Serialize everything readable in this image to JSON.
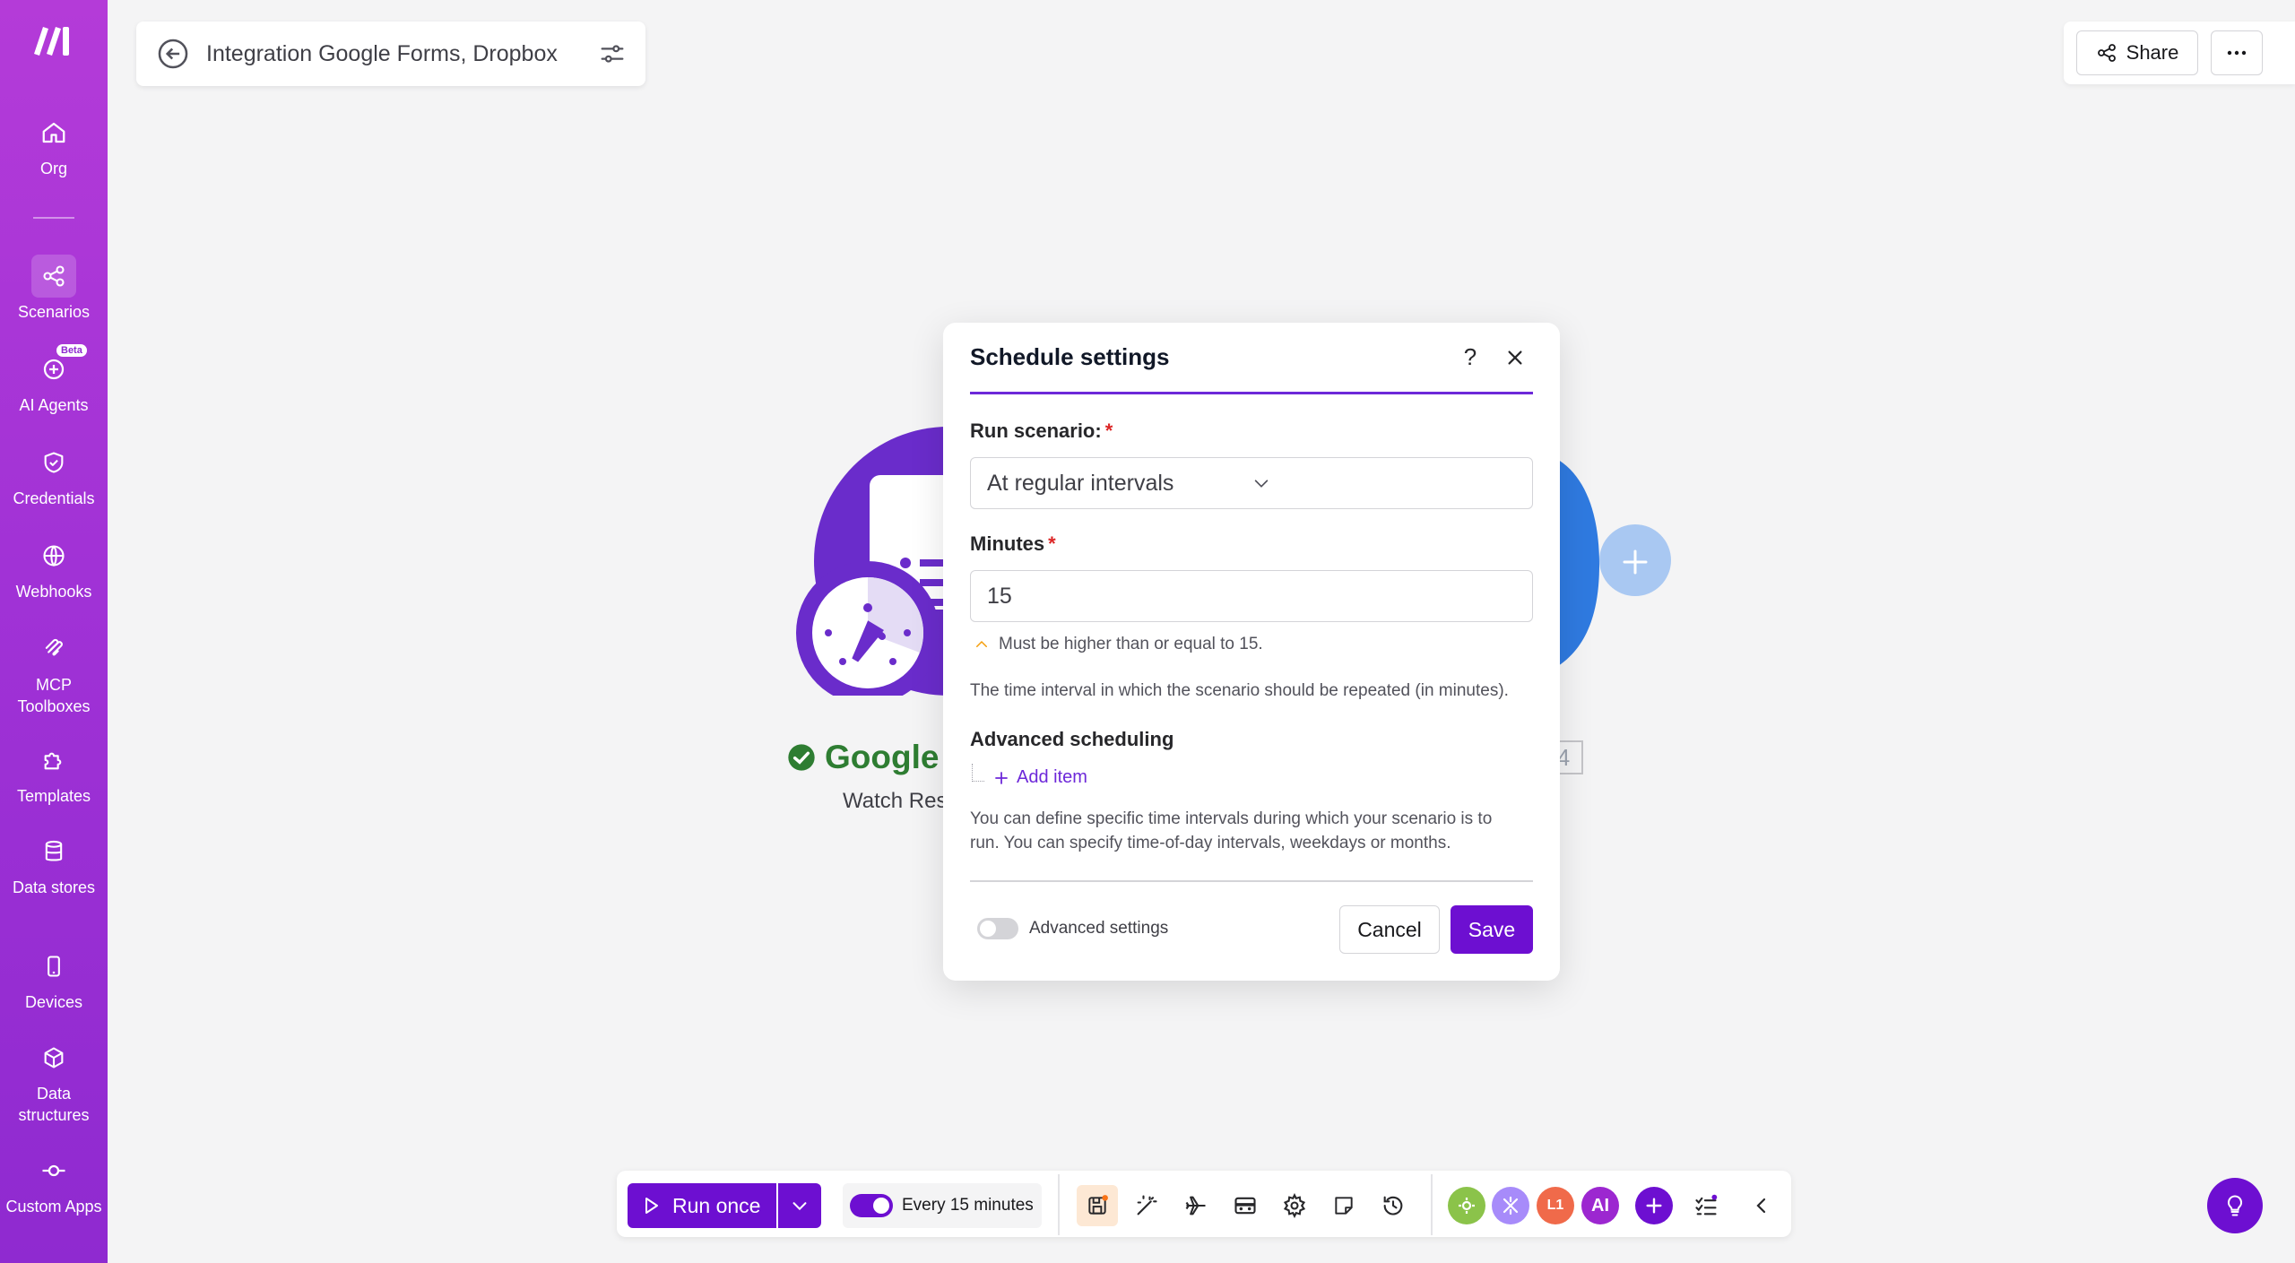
{
  "sidebar": {
    "items": [
      {
        "label": "Org",
        "icon": "home-icon"
      },
      {
        "label": "Scenarios",
        "icon": "share-nodes-icon"
      },
      {
        "label": "AI Agents",
        "icon": "ai-agent-icon",
        "badge": "Beta"
      },
      {
        "label": "Credentials",
        "icon": "shield-icon"
      },
      {
        "label": "Webhooks",
        "icon": "globe-icon"
      },
      {
        "label": "MCP Toolboxes",
        "icon": "mcp-icon"
      },
      {
        "label": "Templates",
        "icon": "puzzle-icon"
      },
      {
        "label": "Data stores",
        "icon": "database-icon"
      },
      {
        "label": "Devices",
        "icon": "phone-icon"
      },
      {
        "label": "Data structures",
        "icon": "cube-icon"
      },
      {
        "label": "Custom Apps",
        "icon": "commit-icon"
      }
    ]
  },
  "header": {
    "title": "Integration Google Forms, Dropbox",
    "share_label": "Share"
  },
  "canvas": {
    "left_module_name": "Google",
    "left_module_sub": "Watch Res",
    "right_module_count": "4"
  },
  "modal": {
    "title": "Schedule settings",
    "help_label": "?",
    "run_scenario_label": "Run scenario:",
    "run_scenario_value": "At regular intervals",
    "minutes_label": "Minutes",
    "minutes_value": "15",
    "required_mark": "*",
    "warning_text": "Must be higher than or equal to 15.",
    "interval_help": "The time interval in which the scenario should be repeated (in minutes).",
    "advanced_scheduling_label": "Advanced scheduling",
    "add_item_label": "Add item",
    "advanced_help_line1": "You can define specific time intervals during which your scenario is to",
    "advanced_help_line2": "run. You can specify time-of-day intervals, weekdays or months.",
    "advanced_settings_label": "Advanced settings",
    "cancel_label": "Cancel",
    "save_label": "Save"
  },
  "toolbar": {
    "run_once_label": "Run once",
    "schedule_label": "Every 15 minutes",
    "avatars": [
      "L1",
      "AI"
    ]
  },
  "colors": {
    "brand": "#6d0fd1",
    "sidebar_top": "#b43bd8",
    "success": "#2e7d32"
  }
}
